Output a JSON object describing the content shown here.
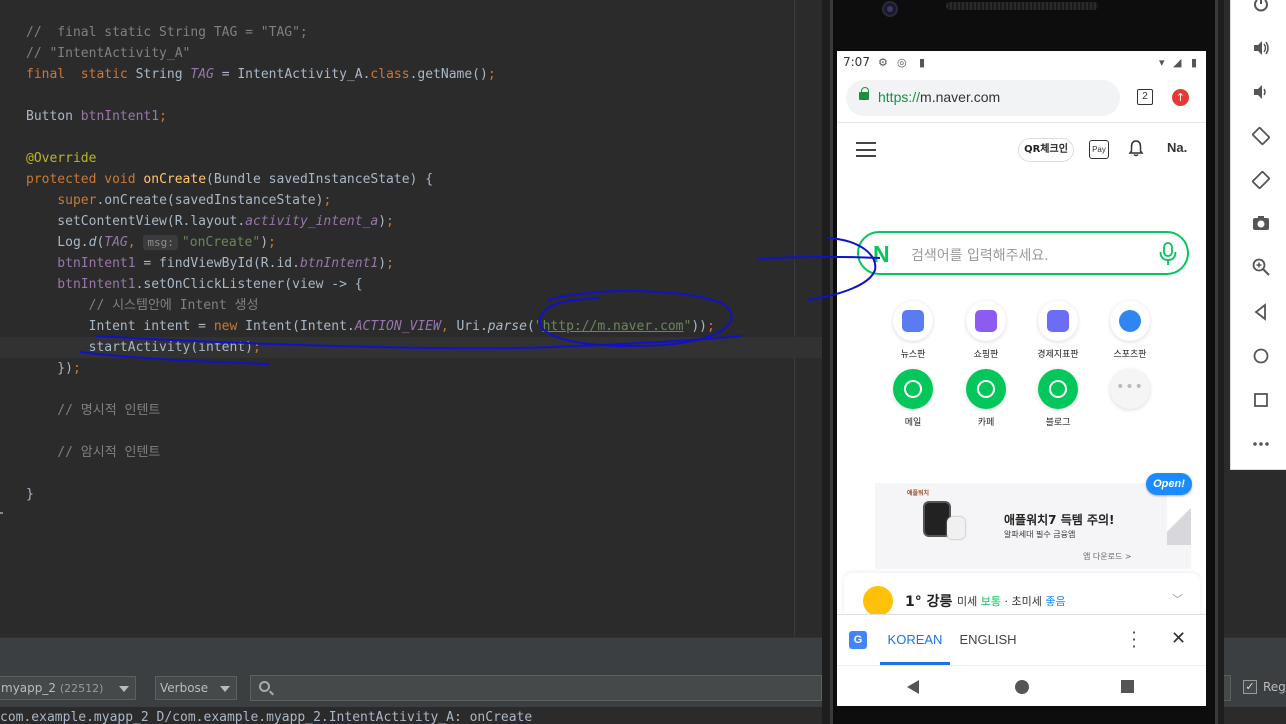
{
  "editor": {
    "lines": [
      [
        {
          "t": "//  final static String TAG = \"TAG\";",
          "c": "cm"
        }
      ],
      [
        {
          "t": "// \"IntentActivity_A\"",
          "c": "cm"
        }
      ],
      [
        {
          "t": "final",
          "c": "kw"
        },
        {
          "t": "  ",
          "c": ""
        },
        {
          "t": "static",
          "c": "kw"
        },
        {
          "t": " String ",
          "c": "type"
        },
        {
          "t": "TAG",
          "c": "fld"
        },
        {
          "t": " = IntentActivity_A.",
          "c": "type"
        },
        {
          "t": "class",
          "c": "kw"
        },
        {
          "t": ".getName()",
          "c": "type"
        },
        {
          "t": ";",
          "c": "kw"
        }
      ],
      [],
      [
        {
          "t": "Button ",
          "c": "type"
        },
        {
          "t": "btnIntent1",
          "c": "fld2"
        },
        {
          "t": ";",
          "c": "kw"
        }
      ],
      [],
      [
        {
          "t": "@Override",
          "c": "ann"
        }
      ],
      [
        {
          "t": "protected",
          "c": "kw"
        },
        {
          "t": " ",
          "c": ""
        },
        {
          "t": "void",
          "c": "kw"
        },
        {
          "t": " ",
          "c": ""
        },
        {
          "t": "onCreate",
          "c": "fn"
        },
        {
          "t": "(Bundle savedInstanceState) {",
          "c": "type"
        }
      ],
      [
        {
          "t": "    ",
          "c": ""
        },
        {
          "t": "super",
          "c": "kw"
        },
        {
          "t": ".onCreate(savedInstanceState)",
          "c": "type"
        },
        {
          "t": ";",
          "c": "kw"
        }
      ],
      [
        {
          "t": "    setContentView(R.layout.",
          "c": "type"
        },
        {
          "t": "activity_intent_a",
          "c": "fld"
        },
        {
          "t": ")",
          "c": "type"
        },
        {
          "t": ";",
          "c": "kw"
        }
      ],
      [
        {
          "t": "    Log.",
          "c": "type"
        },
        {
          "t": "d",
          "c": "it"
        },
        {
          "t": "(",
          "c": "type"
        },
        {
          "t": "TAG",
          "c": "fld"
        },
        {
          "t": ", ",
          "c": "kw"
        },
        {
          "t": "msg:",
          "c": "hint"
        },
        {
          "t": "\"onCreate\"",
          "c": "str"
        },
        {
          "t": ")",
          "c": "type"
        },
        {
          "t": ";",
          "c": "kw"
        }
      ],
      [
        {
          "t": "    btnIntent1",
          "c": "fld2"
        },
        {
          "t": " = findViewById(R.id.",
          "c": "type"
        },
        {
          "t": "btnIntent1",
          "c": "fld"
        },
        {
          "t": ")",
          "c": "type"
        },
        {
          "t": ";",
          "c": "kw"
        }
      ],
      [
        {
          "t": "    btnIntent1",
          "c": "fld2"
        },
        {
          "t": ".setOnClickListener(view -> {",
          "c": "type"
        }
      ],
      [
        {
          "t": "        // 시스템안에 Intent 생성",
          "c": "cm"
        }
      ],
      [
        {
          "t": "        Intent intent = ",
          "c": "type"
        },
        {
          "t": "new",
          "c": "kw"
        },
        {
          "t": " Intent(Intent.",
          "c": "type"
        },
        {
          "t": "ACTION_VIEW",
          "c": "fld"
        },
        {
          "t": ", ",
          "c": "kw"
        },
        {
          "t": "Uri.",
          "c": "type"
        },
        {
          "t": "parse",
          "c": "it"
        },
        {
          "t": "(",
          "c": "type"
        },
        {
          "t": "\"",
          "c": "str"
        },
        {
          "t": "http://m.naver.com",
          "c": "url"
        },
        {
          "t": "\"",
          "c": "str"
        },
        {
          "t": "))",
          "c": "type"
        },
        {
          "t": ";",
          "c": "kw"
        }
      ],
      [
        {
          "t": "        startActivity(intent)",
          "c": "type"
        },
        {
          "t": ";",
          "c": "kw"
        }
      ],
      [
        {
          "t": "    })",
          "c": "type"
        },
        {
          "t": ";",
          "c": "kw"
        }
      ],
      [],
      [
        {
          "t": "    // 명시적 인텐트",
          "c": "cm"
        }
      ],
      [],
      [
        {
          "t": "    // 암시적 인텐트",
          "c": "cm"
        }
      ],
      [],
      [
        {
          "t": "}",
          "c": "type"
        }
      ]
    ],
    "current_line": 15
  },
  "logcat": {
    "process": "myapp_2",
    "process_pid": "(22512)",
    "level": "Verbose",
    "search_value": "",
    "regex_label": "Rege",
    "regex_checked": true,
    "log_line": "com.example.myapp_2 D/com.example.myapp_2.IntentActivity_A: onCreate"
  },
  "phone": {
    "status": {
      "time": "7:07"
    },
    "browser": {
      "url_scheme": "https://",
      "url_host": "m.naver.com",
      "tab_count": "2"
    },
    "naver": {
      "qr_label": "QR체크인",
      "pay_label": "Pay",
      "profile": "Na.",
      "search_logo": "N",
      "search_placeholder": "검색어를 입력해주세요.",
      "shortcuts": [
        {
          "label": "뉴스판",
          "color": "#5b7bf0"
        },
        {
          "label": "쇼핑판",
          "color": "#8c5cf0"
        },
        {
          "label": "경제지표판",
          "color": "#6a6df5"
        },
        {
          "label": "스포츠판",
          "color": "#2f86f0"
        },
        {
          "label": "메일",
          "color": "#03c75a"
        },
        {
          "label": "카페",
          "color": "#03c75a"
        },
        {
          "label": "블로그",
          "color": "#03c75a"
        },
        {
          "label": "",
          "color": "#cccccc"
        }
      ],
      "banner": {
        "brand": "애플워치",
        "title": "애플워치7 득템 주의!",
        "subtitle": "알파세대 필수 금융앱",
        "link": "앱 다운로드 >",
        "badge": "Open!"
      },
      "weather": {
        "temp": "1° 강릉",
        "dust_prefix": "미세 ",
        "dust_val1": "보통",
        "dust_mid": " · 초미세 ",
        "dust_val2": "좋음"
      }
    },
    "translate": {
      "tab_korean": "KOREAN",
      "tab_english": "ENGLISH"
    }
  }
}
